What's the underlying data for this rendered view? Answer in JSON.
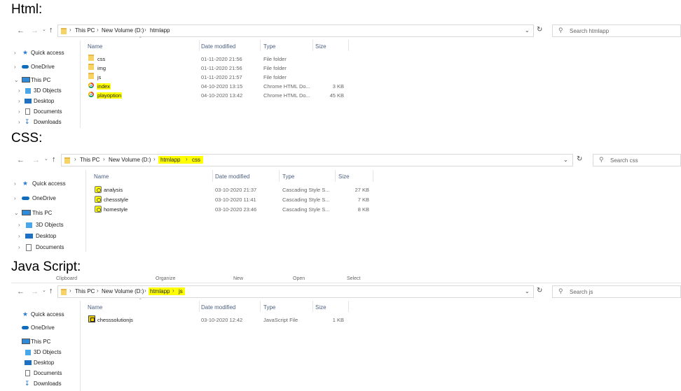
{
  "sections": {
    "html": {
      "heading": "Html:",
      "crumbs": [
        "This PC",
        "New Volume (D:)",
        "htmlapp"
      ],
      "search_placeholder": "Search htmlapp",
      "columns": {
        "name": "Name",
        "date": "Date modified",
        "type": "Type",
        "size": "Size"
      },
      "nav": [
        "Quick access",
        "OneDrive",
        "This PC",
        "3D Objects",
        "Desktop",
        "Documents",
        "Downloads"
      ],
      "rows": [
        {
          "name": "css",
          "date": "01-11-2020 21:56",
          "type": "File folder",
          "size": "",
          "icon": "folder-icon"
        },
        {
          "name": "img",
          "date": "01-11-2020 21:56",
          "type": "File folder",
          "size": "",
          "icon": "folder-icon"
        },
        {
          "name": "js",
          "date": "01-11-2020 21:57",
          "type": "File folder",
          "size": "",
          "icon": "folder-icon"
        },
        {
          "name": "index",
          "date": "04-10-2020 13:15",
          "type": "Chrome HTML Do...",
          "size": "3 KB",
          "icon": "chrome-html-icon"
        },
        {
          "name": "playoption",
          "date": "04-10-2020 13:42",
          "type": "Chrome HTML Do...",
          "size": "45 KB",
          "icon": "chrome-html-icon"
        }
      ]
    },
    "css": {
      "heading": "CSS:",
      "crumbs": [
        "This PC",
        "New Volume (D:)",
        "htmlapp",
        "css"
      ],
      "search_placeholder": "Search css",
      "columns": {
        "name": "Name",
        "date": "Date modified",
        "type": "Type",
        "size": "Size"
      },
      "nav": [
        "Quick access",
        "OneDrive",
        "This PC",
        "3D Objects",
        "Desktop",
        "Documents"
      ],
      "rows": [
        {
          "name": "analysis",
          "date": "03-10-2020 21:37",
          "type": "Cascading Style S...",
          "size": "27 KB",
          "icon": "css-file-icon"
        },
        {
          "name": "chessstyle",
          "date": "03-10-2020 11:41",
          "type": "Cascading Style S...",
          "size": "7 KB",
          "icon": "css-file-icon"
        },
        {
          "name": "homestyle",
          "date": "03-10-2020 23:46",
          "type": "Cascading Style S...",
          "size": "8 KB",
          "icon": "css-file-icon"
        }
      ]
    },
    "js": {
      "heading": "Java Script:",
      "ribbon": [
        "Clipboard",
        "Organize",
        "New",
        "Open",
        "Select"
      ],
      "crumbs": [
        "This PC",
        "New Volume (D:)",
        "htmlapp",
        "js"
      ],
      "search_placeholder": "Search js",
      "columns": {
        "name": "Name",
        "date": "Date modified",
        "type": "Type",
        "size": "Size"
      },
      "nav": [
        "Quick access",
        "OneDrive",
        "This PC",
        "3D Objects",
        "Desktop",
        "Documents",
        "Downloads"
      ],
      "rows": [
        {
          "name": "chesssolutionjs",
          "date": "03-10-2020 12:42",
          "type": "JavaScript File",
          "size": "1 KB",
          "icon": "js-file-icon"
        }
      ]
    }
  },
  "colors": {
    "highlight": "#ffff00",
    "header_text": "#4d6082"
  }
}
